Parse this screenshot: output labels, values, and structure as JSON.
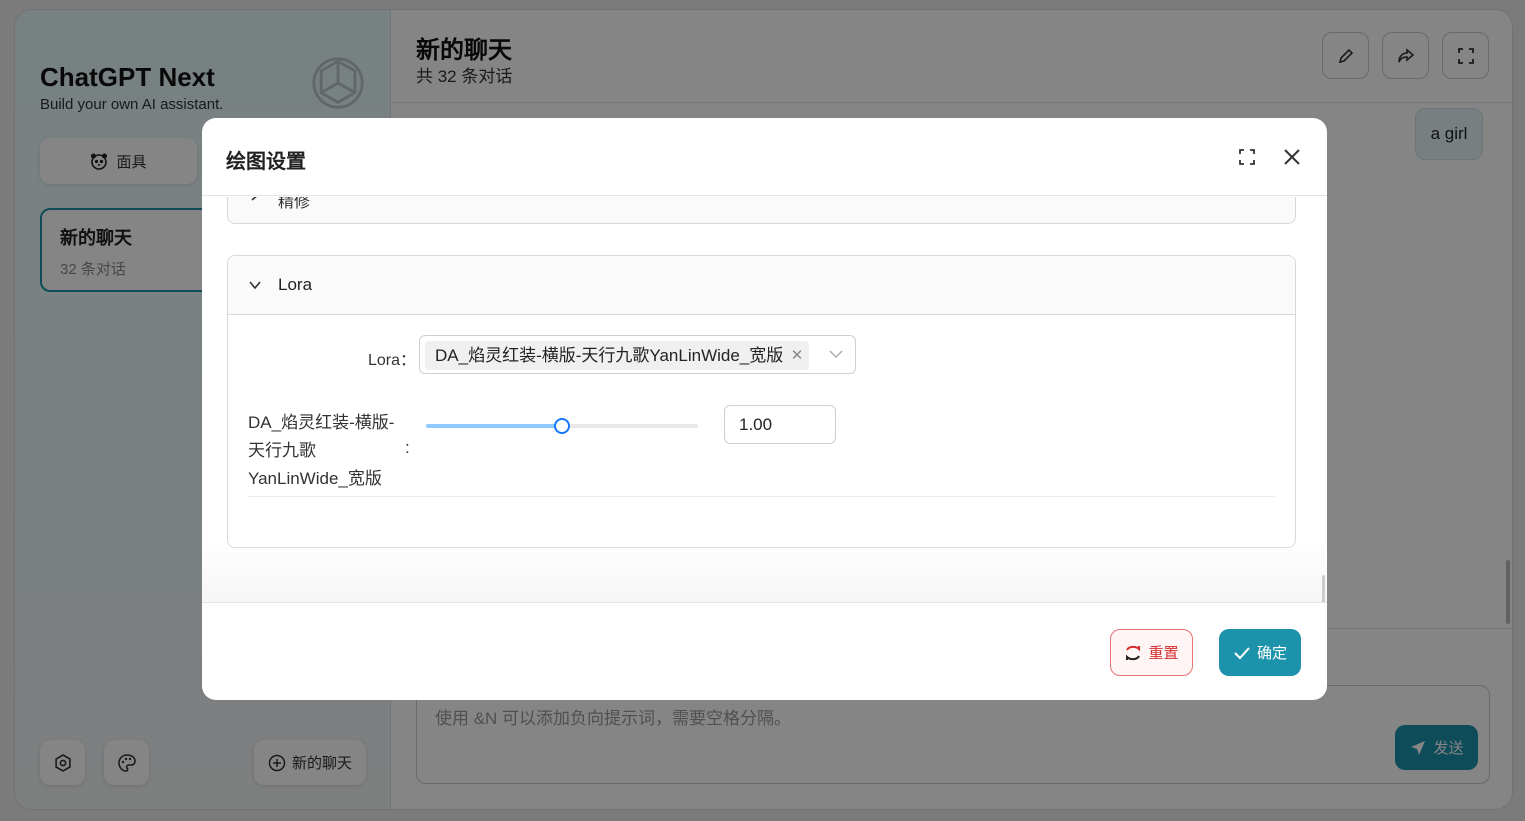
{
  "sidebar": {
    "title": "ChatGPT Next",
    "subtitle": "Build your own AI assistant.",
    "mask_label": "面具",
    "chat_items": [
      {
        "title": "新的聊天",
        "count": "32 条对话"
      }
    ],
    "new_chat_label": "新的聊天"
  },
  "chat": {
    "title": "新的聊天",
    "subtitle": "共 32 条对话",
    "messages": [
      {
        "role": "user",
        "text": "a girl"
      }
    ],
    "input_placeholder": "使用 &N 可以添加负向提示词，需要空格分隔。",
    "send_label": "发送"
  },
  "modal": {
    "title": "绘图设置",
    "prev_section_label": "精修",
    "section": {
      "title": "Lora",
      "lora_label": "Lora",
      "lora_selected": "DA_焰灵红装-横版-天行九歌YanLinWide_宽版",
      "weight_label": "DA_焰灵红装-横版-天行九歌YanLinWide_宽版",
      "weight_value": "1.00",
      "weight_fraction": 0.5
    },
    "reset_label": "重置",
    "confirm_label": "确定"
  },
  "colors": {
    "accent": "#1d93ab",
    "danger": "#d32f2f",
    "slider": "#1677ff"
  }
}
